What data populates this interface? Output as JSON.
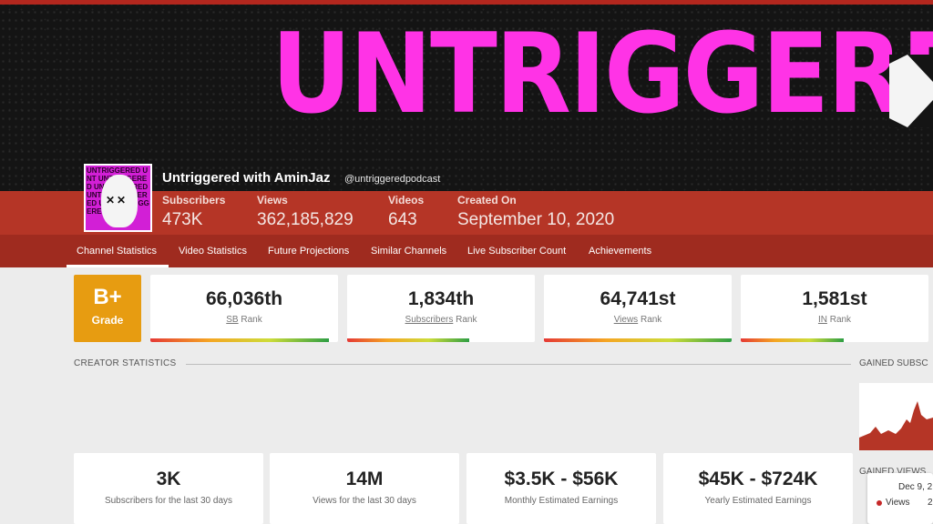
{
  "banner": {
    "text": "UNTRIGGERED"
  },
  "channel": {
    "name": "Untriggered with AminJaz",
    "handle": "@untriggeredpodcast",
    "avatar_text": "UNTRIGGERED UNT UNTRIGGERED UNTRIGGERED UNT UNTRIGGERED UNT UNTRIGGERED UNT"
  },
  "stats": [
    {
      "label": "Subscribers",
      "value": "473K"
    },
    {
      "label": "Views",
      "value": "362,185,829"
    },
    {
      "label": "Videos",
      "value": "643"
    },
    {
      "label": "Created On",
      "value": "September 10, 2020"
    }
  ],
  "nav": [
    {
      "label": "Channel Statistics"
    },
    {
      "label": "Video Statistics"
    },
    {
      "label": "Future Projections"
    },
    {
      "label": "Similar Channels"
    },
    {
      "label": "Live Subscriber Count"
    },
    {
      "label": "Achievements"
    }
  ],
  "grade": {
    "value": "B+",
    "label": "Grade"
  },
  "ranks": [
    {
      "value": "66,036th",
      "key": "SB",
      "suffix": " Rank",
      "bar_fraction": 0.95
    },
    {
      "value": "1,834th",
      "key": "Subscribers",
      "suffix": " Rank",
      "bar_fraction": 0.65
    },
    {
      "value": "64,741st",
      "key": "Views",
      "suffix": " Rank",
      "bar_fraction": 1.0
    },
    {
      "value": "1,581st",
      "key": "IN",
      "suffix": " Rank",
      "bar_fraction": 0.55
    }
  ],
  "sections": {
    "creator": "CREATOR STATISTICS",
    "gained_subs": "GAINED SUBSC",
    "gained_views": "GAINED VIEWS"
  },
  "tooltip": {
    "date": "Dec 9, 2",
    "series": "Views",
    "value": "2"
  },
  "estimates": [
    {
      "value": "3K",
      "label": "Subscribers for the last 30 days"
    },
    {
      "value": "14M",
      "label": "Views for the last 30 days"
    },
    {
      "value": "$3.5K - $56K",
      "label": "Monthly Estimated Earnings"
    },
    {
      "value": "$45K - $724K",
      "label": "Yearly Estimated Earnings"
    }
  ],
  "colors": {
    "header": "#b53526",
    "nav": "#9f2b1f",
    "grade": "#e79c11",
    "banner_text": "#ff33e6"
  }
}
